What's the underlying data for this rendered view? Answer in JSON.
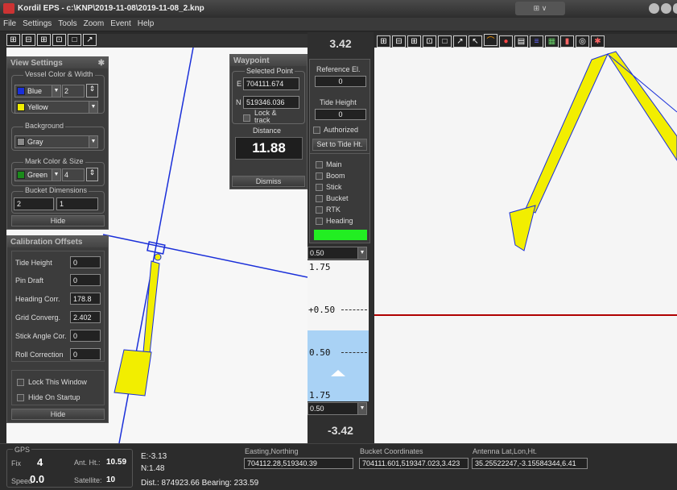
{
  "window": {
    "title": "Kordil EPS - c:\\KNP\\2019-11-08\\2019-11-08_2.knp"
  },
  "menu": [
    "File",
    "Settings",
    "Tools",
    "Zoom",
    "Event",
    "Help"
  ],
  "toolbar_left": [
    "zoom-in-icon",
    "zoom-out-icon",
    "zoom-fit-icon",
    "zoom-window-icon",
    "zoom-extent-icon",
    "pan-icon"
  ],
  "toolbar_right": [
    "zoom-in-icon",
    "zoom-out-icon",
    "zoom-fit-icon",
    "zoom-window-icon",
    "zoom-extent-icon",
    "pan-icon",
    "pointer-icon",
    "measure-icon",
    "tide-icon",
    "layer-icon",
    "list-icon",
    "chart-icon",
    "flag-icon",
    "target-icon",
    "settings-icon"
  ],
  "view_settings": {
    "title": "View Settings",
    "vessel_group": "Vessel Color & Width",
    "vessel_color": "Blue",
    "vessel_width": "2",
    "vessel_color2": "Yellow",
    "background_group": "Background",
    "background_color": "Gray",
    "mark_group": "Mark Color & Size",
    "mark_color": "Green",
    "mark_size": "4",
    "bucket_group": "Bucket Dimensions",
    "bucket_w": "2",
    "bucket_h": "1",
    "hide": "Hide",
    "colors": {
      "blue": "#1a2fd9",
      "yellow": "#f2ee00",
      "gray": "#8a8a8a",
      "green": "#1a8a1a"
    }
  },
  "calibration": {
    "title": "Calibration Offsets",
    "rows": [
      {
        "label": "Tide Height",
        "value": "0"
      },
      {
        "label": "Pin Draft",
        "value": "0"
      },
      {
        "label": "Heading Corr.",
        "value": "178.8"
      },
      {
        "label": "Grid Converg.",
        "value": "2.402"
      },
      {
        "label": "Stick Angle Cor.",
        "value": "0"
      },
      {
        "label": "Roll Correction",
        "value": "0"
      }
    ],
    "lock_window": "Lock This Window",
    "hide_on_startup": "Hide On Startup",
    "hide": "Hide"
  },
  "waypoint": {
    "title": "Waypoint",
    "selected_point": "Selected Point",
    "e_label": "E",
    "e_value": "704111.674",
    "n_label": "N",
    "n_value": "519346.036",
    "lock_track": "Lock & track",
    "distance_label": "Distance",
    "distance_value": "11.88",
    "dismiss": "Dismiss"
  },
  "middle": {
    "top_value": "3.42",
    "reference_label": "Reference El.",
    "reference_value": "0",
    "tide_label": "Tide Height",
    "tide_value": "0",
    "authorized": "Authorized",
    "set_tide": "Set to Tide Ht.",
    "layers": [
      "Main",
      "Boom",
      "Stick",
      "Bucket",
      "RTK",
      "Heading"
    ],
    "status_color": "#22ee22",
    "scale_top": "0.50",
    "gauge_top": "1.75",
    "gauge_mid_upper": "+0.50",
    "gauge_mid_lower": "0.50",
    "gauge_bottom": "1.75",
    "scale_bottom": "0.50",
    "bottom_value": "-3.42"
  },
  "status": {
    "gps_label": "GPS",
    "fix_label": "Fix",
    "fix_value": "4",
    "ant_label": "Ant. Ht.:",
    "ant_value": "10.59",
    "speed_label": "Speed",
    "speed_value": "0.0",
    "sat_label": "Satellite:",
    "sat_value": "10",
    "e_offset": "E:-3.13",
    "n_offset": "N:1.48",
    "dist_bearing": "Dist.: 874923.66 Bearing: 233.59",
    "en_label": "Easting,Northing",
    "en_value": "704112.28,519340.39",
    "bucket_label": "Bucket Coordinates",
    "bucket_value": "704111.601,519347.023,3.423",
    "antenna_label": "Antenna Lat,Lon,Ht.",
    "antenna_value": "35.25522247,-3.15584344,6.41"
  }
}
